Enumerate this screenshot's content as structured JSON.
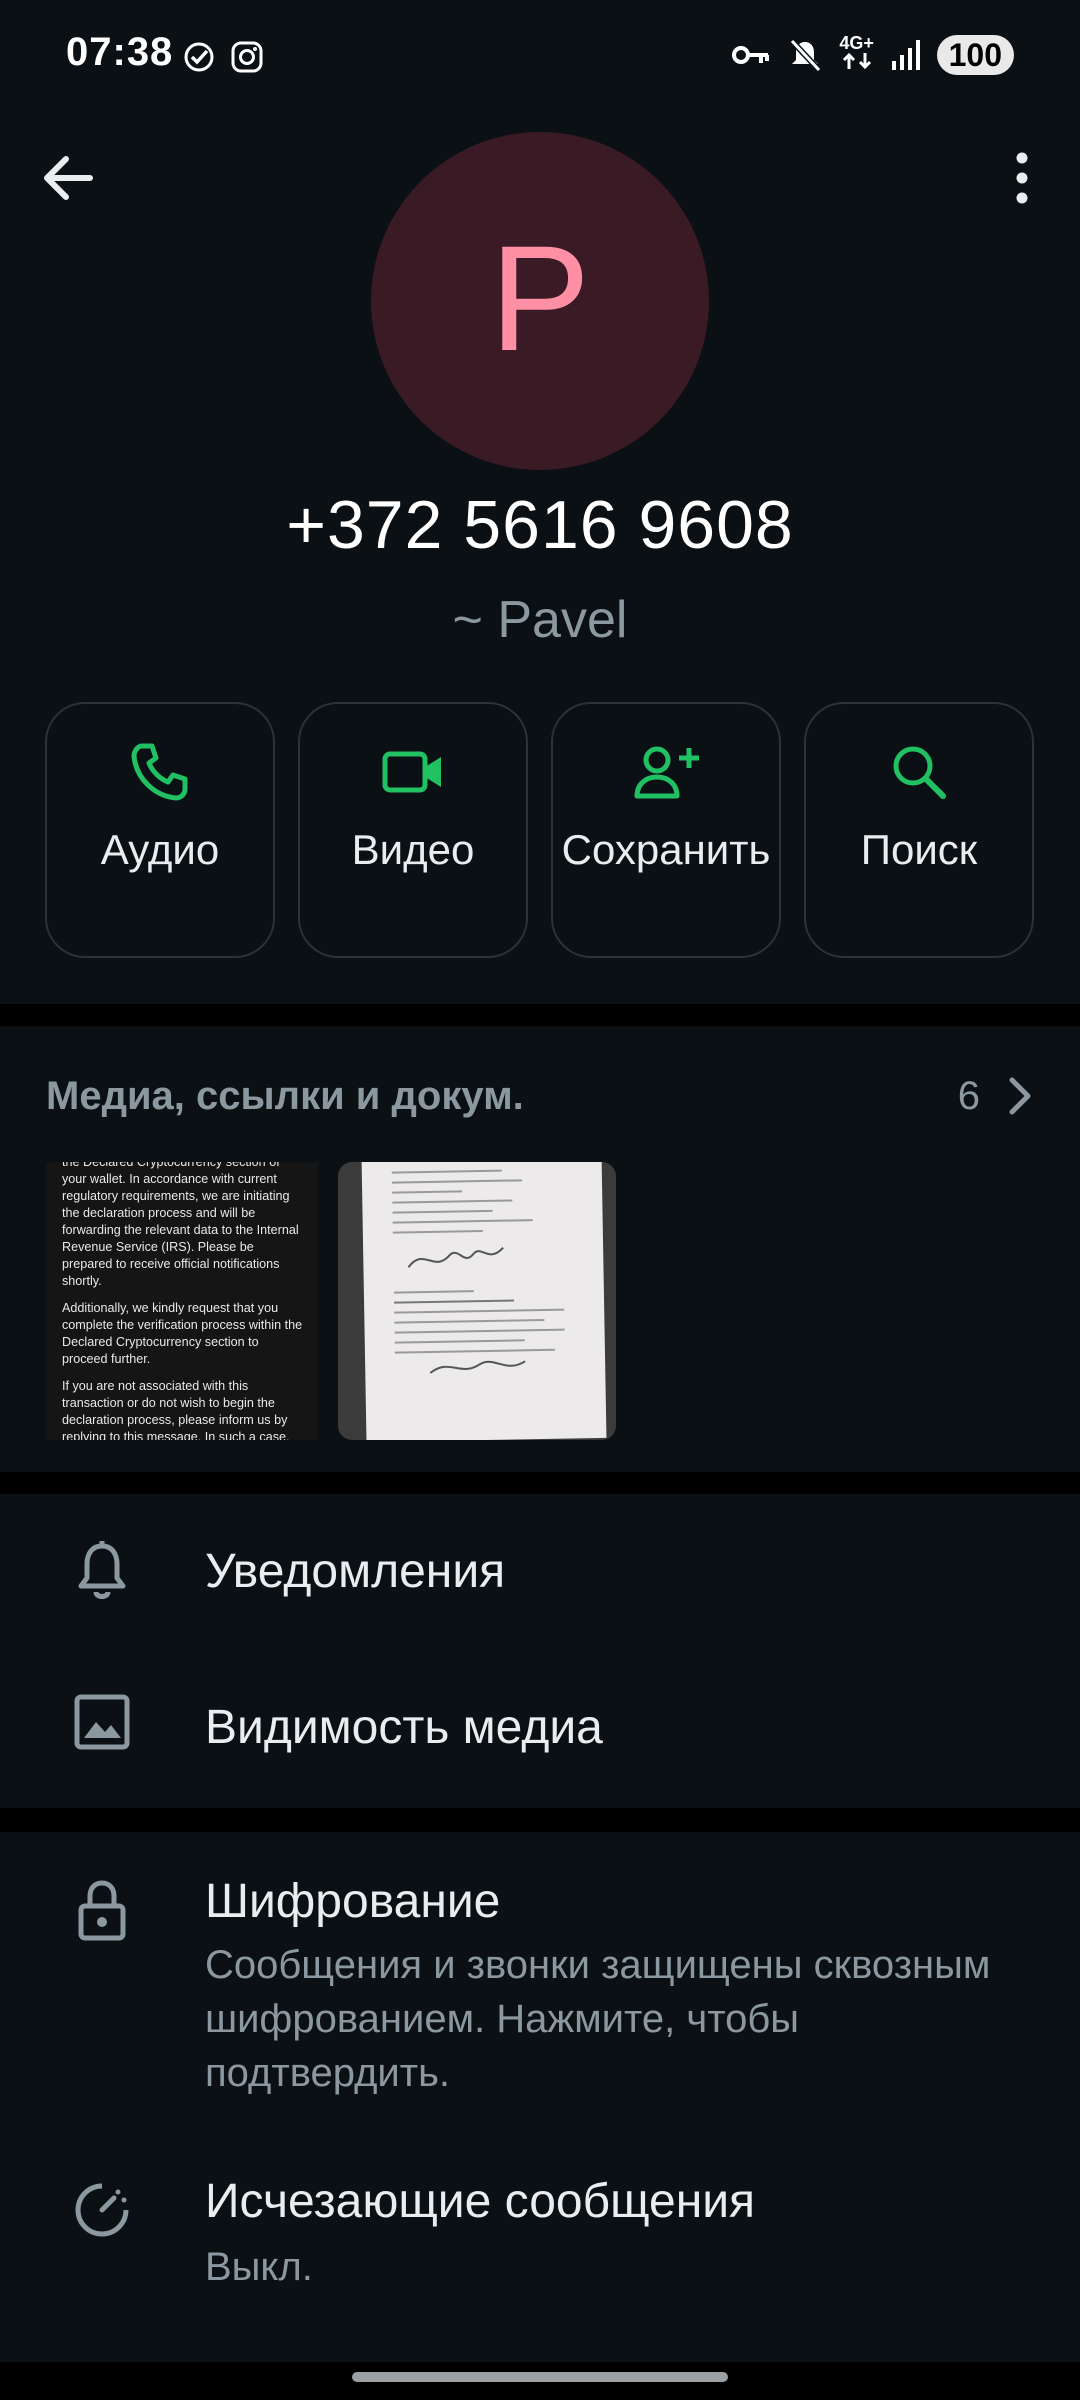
{
  "status_bar": {
    "time": "07:38",
    "network": "4G+",
    "battery": "100"
  },
  "header": {
    "back_icon": "arrow-left-icon",
    "menu_icon": "more-vertical-icon"
  },
  "contact": {
    "avatar_letter": "P",
    "avatar_bg": "#3a1a25",
    "avatar_fg": "#ff8fa4",
    "phone": "+372 5616 9608",
    "alias": "~ Pavel"
  },
  "actions": [
    {
      "label": "Аудио",
      "icon": "phone-icon"
    },
    {
      "label": "Видео",
      "icon": "video-icon"
    },
    {
      "label": "Сохранить",
      "icon": "add-contact-icon"
    },
    {
      "label": "Поиск",
      "icon": "search-icon"
    }
  ],
  "media": {
    "title": "Медиа, ссылки и докум.",
    "count": "6",
    "thumb_text": [
      "the Declared Cryptocurrency section of your wallet. In accordance with current regulatory requirements, we are initiating the declaration process and will be forwarding the relevant data to the Internal Revenue Service (IRS). Please be prepared to receive official notifications shortly.",
      "Additionally, we kindly request that you complete the verification process within the Declared Cryptocurrency section to proceed further.",
      "If you are not associated with this transaction or do not wish to begin the declaration process, please inform us by replying to this message. In such a case, we also ask that you submit Form W-"
    ]
  },
  "settings": {
    "notifications": "Уведомления",
    "media_visibility": "Видимость медиа",
    "encryption_title": "Шифрование",
    "encryption_sub": "Сообщения и звонки защищены сквозным шифрованием. Нажмите, чтобы подтвердить.",
    "disappearing_title": "Исчезающие сообщения",
    "disappearing_sub": "Выкл."
  },
  "colors": {
    "accent": "#21c063",
    "background": "#0b1014",
    "text_primary": "#e9edef",
    "text_secondary": "#8b989f"
  }
}
